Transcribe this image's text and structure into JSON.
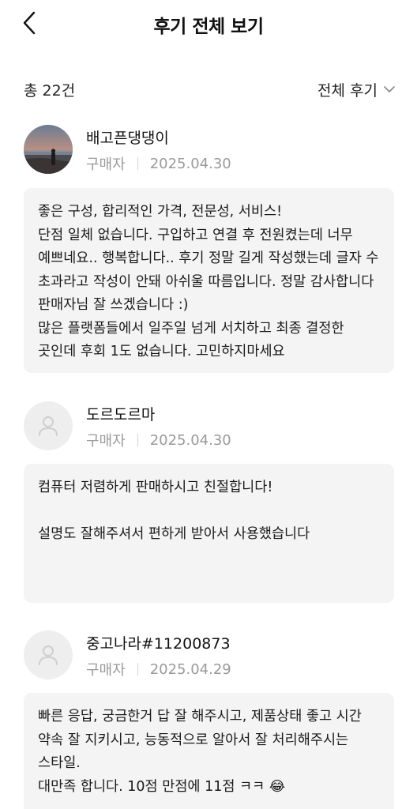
{
  "header": {
    "title": "후기 전체 보기"
  },
  "summary": {
    "total": "총 22건",
    "filter_label": "전체 후기"
  },
  "reviews": [
    {
      "name": "배고픈댕댕이",
      "role": "구매자",
      "date": "2025.04.30",
      "text": "좋은 구성, 합리적인 가격, 전문성, 서비스!\n단점 일체 없습니다. 구입하고 연결 후 전원켰는데 너무 예쁘네요.. 행복합니다.. 후기 정말 길게 작성했는데 글자 수 초과라고 작성이 안돼 아쉬울 따름입니다. 정말 감사합니다 판매자님 잘 쓰겠습니다 :)\n많은 플랫폼들에서 일주일 넘게 서치하고 최종 결정한 곳인데 후회 1도 없습니다. 고민하지마세요"
    },
    {
      "name": "도르도르마",
      "role": "구매자",
      "date": "2025.04.30",
      "text": "컴퓨터 저렴하게 판매하시고 친절합니다!\n\n설명도 잘해주셔서 편하게 받아서 사용했습니다"
    },
    {
      "name": "중고나라#11200873",
      "role": "구매자",
      "date": "2025.04.29",
      "text": "빠른 응답, 궁금한거 답 잘 해주시고, 제품상태 좋고 시간 약속 잘 지키시고, 능동적으로 알아서 잘 처리해주시는 스타일.\n대만족 합니다. 10점 만점에 11점 ㅋㅋ 😂"
    }
  ]
}
